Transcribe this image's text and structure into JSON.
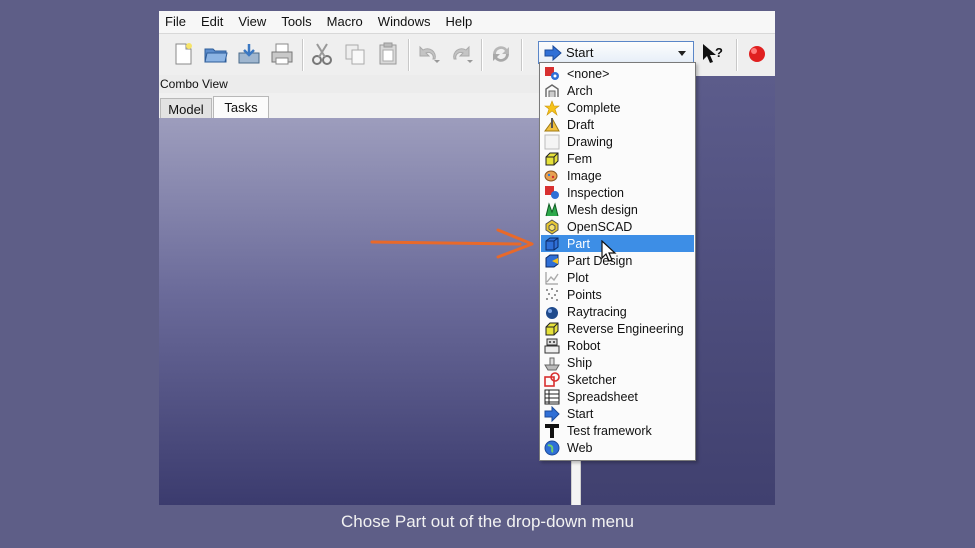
{
  "menubar": {
    "items": [
      "File",
      "Edit",
      "View",
      "Tools",
      "Macro",
      "Windows",
      "Help"
    ]
  },
  "toolbar": {
    "icons": [
      "new-file-icon",
      "open-folder-icon",
      "save-icon",
      "print-icon",
      "cut-icon",
      "copy-icon",
      "paste-icon",
      "undo-icon",
      "redo-icon",
      "refresh-icon",
      "whats-this-icon",
      "record-macro-icon"
    ],
    "workbench_selector": {
      "selected": "Start",
      "icon": "arrow-right-icon"
    }
  },
  "combo_view": {
    "title": "Combo View",
    "tabs": [
      "Model",
      "Tasks"
    ],
    "active_tab": "Tasks"
  },
  "dropdown": {
    "selected": "Part",
    "items": [
      {
        "label": "<none>",
        "icon": "none-gear-icon"
      },
      {
        "label": "Arch",
        "icon": "arch-icon"
      },
      {
        "label": "Complete",
        "icon": "star-icon"
      },
      {
        "label": "Draft",
        "icon": "draft-icon"
      },
      {
        "label": "Drawing",
        "icon": "drawing-icon"
      },
      {
        "label": "Fem",
        "icon": "fem-icon"
      },
      {
        "label": "Image",
        "icon": "image-icon"
      },
      {
        "label": "Inspection",
        "icon": "inspection-icon"
      },
      {
        "label": "Mesh design",
        "icon": "mesh-icon"
      },
      {
        "label": "OpenSCAD",
        "icon": "openscad-icon"
      },
      {
        "label": "Part",
        "icon": "part-cube-icon"
      },
      {
        "label": "Part Design",
        "icon": "part-design-icon"
      },
      {
        "label": "Plot",
        "icon": "plot-icon"
      },
      {
        "label": "Points",
        "icon": "points-icon"
      },
      {
        "label": "Raytracing",
        "icon": "raytracing-icon"
      },
      {
        "label": "Reverse Engineering",
        "icon": "reverse-engineering-icon"
      },
      {
        "label": "Robot",
        "icon": "robot-icon"
      },
      {
        "label": "Ship",
        "icon": "ship-icon"
      },
      {
        "label": "Sketcher",
        "icon": "sketcher-icon"
      },
      {
        "label": "Spreadsheet",
        "icon": "spreadsheet-icon"
      },
      {
        "label": "Start",
        "icon": "start-arrow-icon"
      },
      {
        "label": "Test framework",
        "icon": "test-framework-icon"
      },
      {
        "label": "Web",
        "icon": "web-globe-icon"
      }
    ]
  },
  "annotation": {
    "arrow_color": "#e8692a",
    "pointer": "mouse-cursor"
  },
  "caption": "Chose Part out of the drop-down menu",
  "colors": {
    "background": "#5e5e87",
    "selection": "#3d8ee6",
    "record": "#e02020"
  }
}
